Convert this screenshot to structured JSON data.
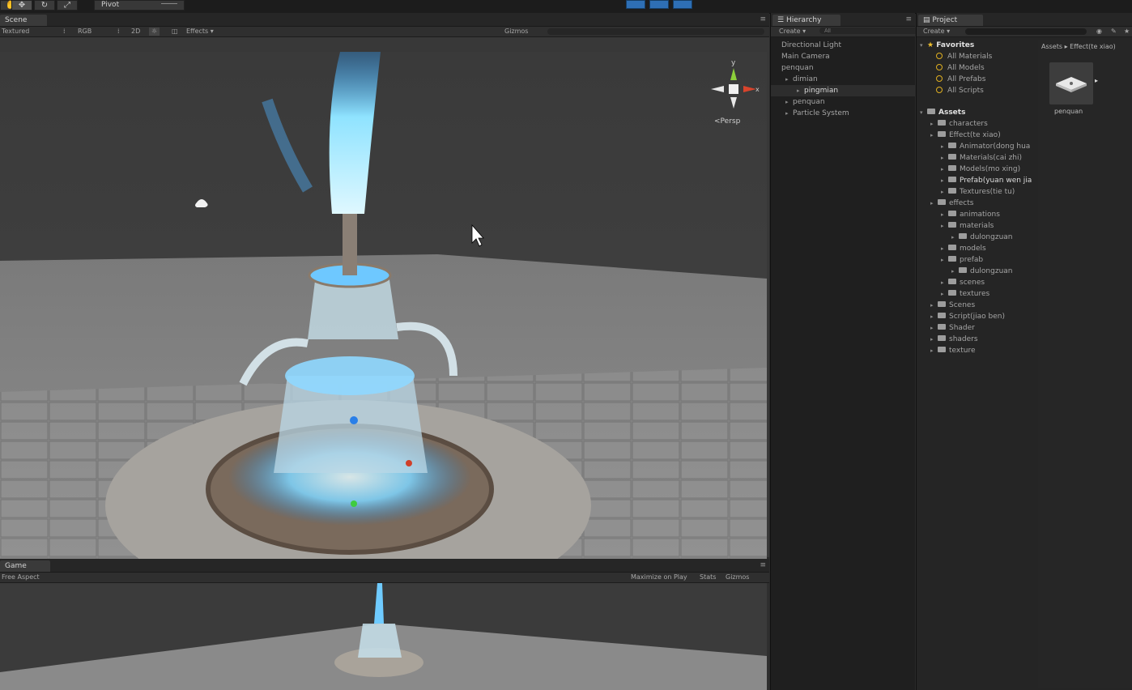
{
  "toolbar": {
    "pivot_label": "Pivot",
    "accent": "#2e6fb5"
  },
  "scene": {
    "tab": "Scene",
    "shading_mode": "Textured",
    "render_mode": "RGB",
    "mode_2d": "2D",
    "effects": "Effects",
    "gizmos": "Gizmos",
    "axis_y": "y",
    "axis_x": "x",
    "persp": "Persp"
  },
  "game": {
    "tab": "Game",
    "aspect": "Free Aspect",
    "maximize": "Maximize on Play",
    "stats": "Stats",
    "gizmos": "Gizmos"
  },
  "hierarchy": {
    "tab": "Hierarchy",
    "create": "Create",
    "search_placeholder": "All",
    "items": [
      {
        "label": "Directional Light",
        "indent": 0,
        "selected": false
      },
      {
        "label": "Main Camera",
        "indent": 0,
        "selected": false
      },
      {
        "label": "penquan",
        "indent": 0,
        "selected": false
      },
      {
        "label": "dimian",
        "indent": 1,
        "selected": false
      },
      {
        "label": "pingmian",
        "indent": 2,
        "selected": true
      },
      {
        "label": "penquan",
        "indent": 1,
        "selected": false
      },
      {
        "label": "Particle System",
        "indent": 1,
        "selected": false
      }
    ]
  },
  "project": {
    "tab": "Project",
    "create": "Create",
    "favorites_title": "Favorites",
    "favorites": [
      "All Materials",
      "All Models",
      "All Prefabs",
      "All Scripts"
    ],
    "assets_title": "Assets",
    "breadcrumb_root": "Assets",
    "breadcrumb_current": "Effect(te xiao)",
    "preview_label": "penquan",
    "tree": [
      {
        "label": "characters",
        "indent": 1,
        "bright": false
      },
      {
        "label": "Effect(te xiao)",
        "indent": 1,
        "bright": false
      },
      {
        "label": "Animator(dong hua",
        "indent": 2,
        "bright": false
      },
      {
        "label": "Materials(cai zhi)",
        "indent": 2,
        "bright": false
      },
      {
        "label": "Models(mo xing)",
        "indent": 2,
        "bright": false
      },
      {
        "label": "Prefab(yuan wen jia",
        "indent": 2,
        "bright": true
      },
      {
        "label": "Textures(tie tu)",
        "indent": 2,
        "bright": false
      },
      {
        "label": "effects",
        "indent": 1,
        "bright": false
      },
      {
        "label": "animations",
        "indent": 2,
        "bright": false
      },
      {
        "label": "materials",
        "indent": 2,
        "bright": false
      },
      {
        "label": "dulongzuan",
        "indent": 3,
        "bright": false
      },
      {
        "label": "models",
        "indent": 2,
        "bright": false
      },
      {
        "label": "prefab",
        "indent": 2,
        "bright": false
      },
      {
        "label": "dulongzuan",
        "indent": 3,
        "bright": false
      },
      {
        "label": "scenes",
        "indent": 2,
        "bright": false
      },
      {
        "label": "textures",
        "indent": 2,
        "bright": false
      },
      {
        "label": "Scenes",
        "indent": 1,
        "bright": false
      },
      {
        "label": "Script(jiao ben)",
        "indent": 1,
        "bright": false
      },
      {
        "label": "Shader",
        "indent": 1,
        "bright": false
      },
      {
        "label": "shaders",
        "indent": 1,
        "bright": false
      },
      {
        "label": "texture",
        "indent": 1,
        "bright": false
      }
    ]
  }
}
